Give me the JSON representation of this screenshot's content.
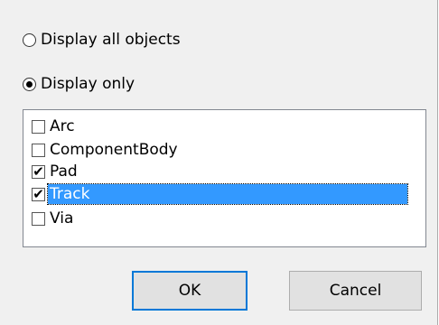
{
  "display_mode": {
    "all_label": "Display all objects",
    "only_label": "Display only",
    "selected": "only"
  },
  "object_list": {
    "items": [
      {
        "label": "Arc",
        "checked": false,
        "selected": false
      },
      {
        "label": "ComponentBody",
        "checked": false,
        "selected": false
      },
      {
        "label": "Pad",
        "checked": true,
        "selected": false
      },
      {
        "label": "Track",
        "checked": true,
        "selected": true
      },
      {
        "label": "Via",
        "checked": false,
        "selected": false
      }
    ]
  },
  "buttons": {
    "ok_label": "OK",
    "cancel_label": "Cancel"
  },
  "icons": {
    "check_glyph": "✔"
  },
  "colors": {
    "selection": "#3399ff",
    "default_button_border": "#0078d7"
  }
}
